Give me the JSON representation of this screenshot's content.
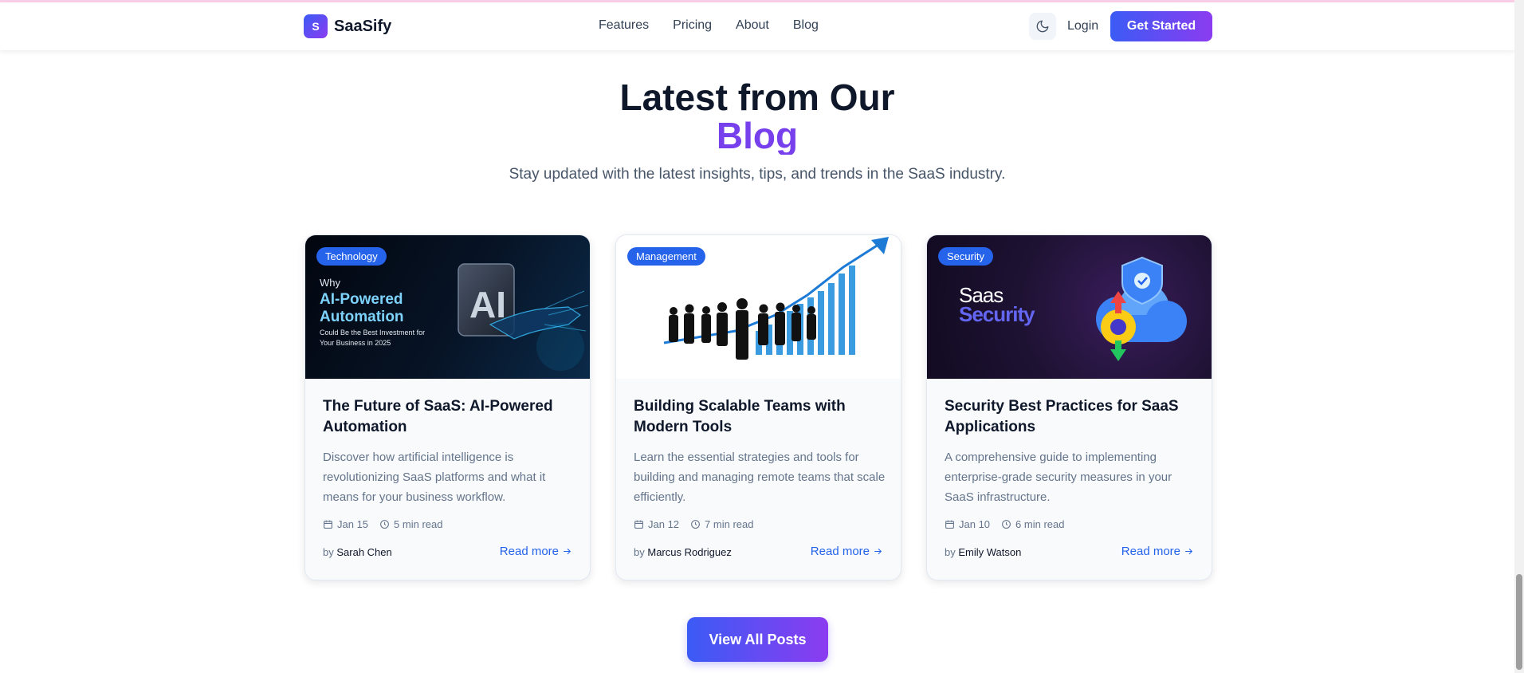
{
  "nav": {
    "brand_initial": "S",
    "brand_name": "SaaSify",
    "links": [
      "Features",
      "Pricing",
      "About",
      "Blog"
    ],
    "login": "Login",
    "cta": "Get Started",
    "theme_icon": "moon-icon"
  },
  "section": {
    "title": "Latest from Our",
    "title_accent": "Blog",
    "subtitle": "Stay updated with the latest insights, tips, and trends in the SaaS industry."
  },
  "posts": [
    {
      "category": "Technology",
      "image_text": {
        "line1": "Why",
        "line2": "AI-Powered",
        "line3": "Automation",
        "line4": "Could Be the Best Investment for",
        "line5": "Your Business in 2025",
        "mark": "AI"
      },
      "title": "The Future of SaaS: AI-Powered Automation",
      "description": "Discover how artificial intelligence is revolutionizing SaaS platforms and what it means for your business workflow.",
      "date": "Jan 15",
      "read_time": "5 min read",
      "by": "by",
      "author": "Sarah Chen",
      "read_more": "Read more"
    },
    {
      "category": "Management",
      "title": "Building Scalable Teams with Modern Tools",
      "description": "Learn the essential strategies and tools for building and managing remote teams that scale efficiently.",
      "date": "Jan 12",
      "read_time": "7 min read",
      "by": "by",
      "author": "Marcus Rodriguez",
      "read_more": "Read more"
    },
    {
      "category": "Security",
      "image_text": {
        "line1": "Saas",
        "line2": "Security"
      },
      "title": "Security Best Practices for SaaS Applications",
      "description": "A comprehensive guide to implementing enterprise-grade security measures in your SaaS infrastructure.",
      "date": "Jan 10",
      "read_time": "6 min read",
      "by": "by",
      "author": "Emily Watson",
      "read_more": "Read more"
    }
  ],
  "view_all": "View All Posts",
  "colors": {
    "accent_blue": "#2563eb",
    "gradient_start": "#3b5bf5",
    "gradient_end": "#8b3cf0"
  }
}
